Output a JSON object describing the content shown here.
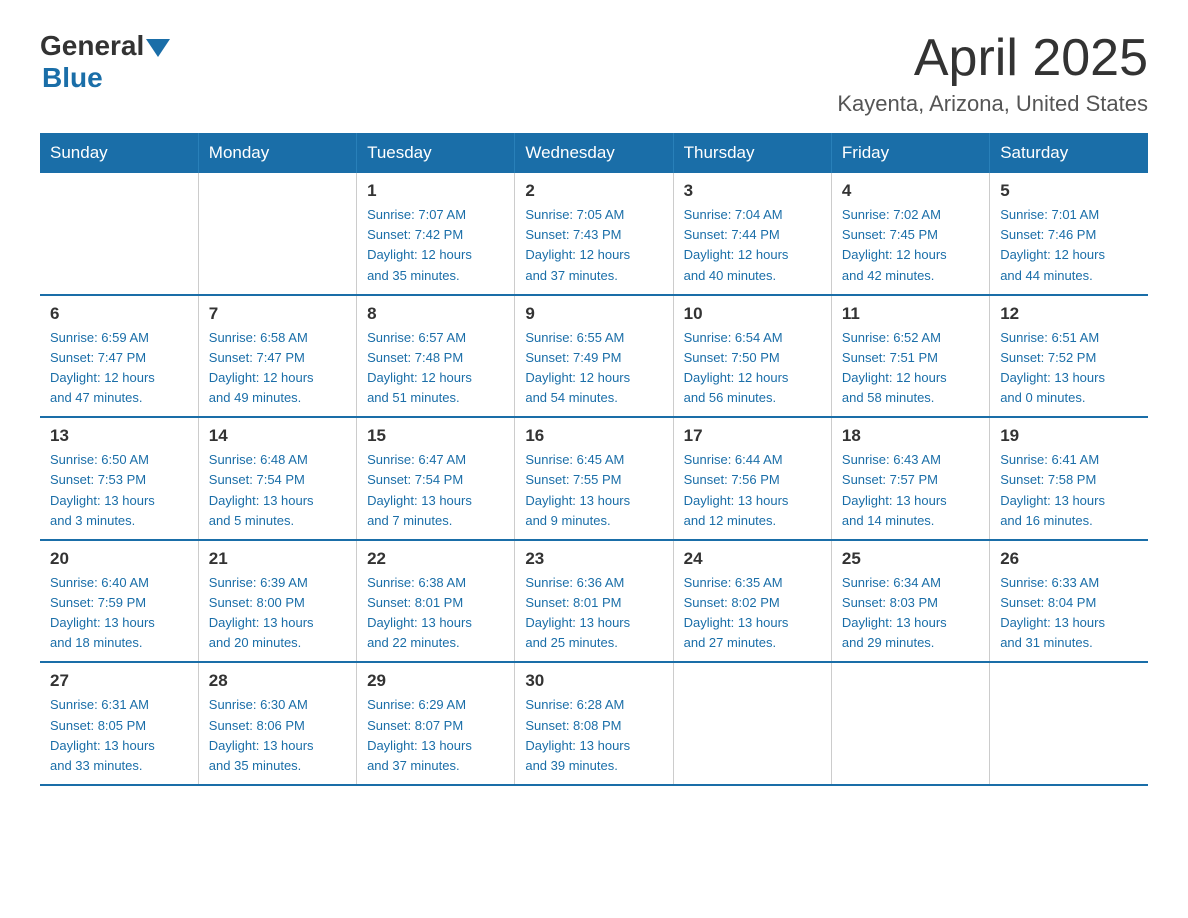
{
  "header": {
    "logo_general": "General",
    "logo_blue": "Blue",
    "month_title": "April 2025",
    "location": "Kayenta, Arizona, United States"
  },
  "days_of_week": [
    "Sunday",
    "Monday",
    "Tuesday",
    "Wednesday",
    "Thursday",
    "Friday",
    "Saturday"
  ],
  "weeks": [
    [
      {
        "day": "",
        "info": ""
      },
      {
        "day": "",
        "info": ""
      },
      {
        "day": "1",
        "info": "Sunrise: 7:07 AM\nSunset: 7:42 PM\nDaylight: 12 hours\nand 35 minutes."
      },
      {
        "day": "2",
        "info": "Sunrise: 7:05 AM\nSunset: 7:43 PM\nDaylight: 12 hours\nand 37 minutes."
      },
      {
        "day": "3",
        "info": "Sunrise: 7:04 AM\nSunset: 7:44 PM\nDaylight: 12 hours\nand 40 minutes."
      },
      {
        "day": "4",
        "info": "Sunrise: 7:02 AM\nSunset: 7:45 PM\nDaylight: 12 hours\nand 42 minutes."
      },
      {
        "day": "5",
        "info": "Sunrise: 7:01 AM\nSunset: 7:46 PM\nDaylight: 12 hours\nand 44 minutes."
      }
    ],
    [
      {
        "day": "6",
        "info": "Sunrise: 6:59 AM\nSunset: 7:47 PM\nDaylight: 12 hours\nand 47 minutes."
      },
      {
        "day": "7",
        "info": "Sunrise: 6:58 AM\nSunset: 7:47 PM\nDaylight: 12 hours\nand 49 minutes."
      },
      {
        "day": "8",
        "info": "Sunrise: 6:57 AM\nSunset: 7:48 PM\nDaylight: 12 hours\nand 51 minutes."
      },
      {
        "day": "9",
        "info": "Sunrise: 6:55 AM\nSunset: 7:49 PM\nDaylight: 12 hours\nand 54 minutes."
      },
      {
        "day": "10",
        "info": "Sunrise: 6:54 AM\nSunset: 7:50 PM\nDaylight: 12 hours\nand 56 minutes."
      },
      {
        "day": "11",
        "info": "Sunrise: 6:52 AM\nSunset: 7:51 PM\nDaylight: 12 hours\nand 58 minutes."
      },
      {
        "day": "12",
        "info": "Sunrise: 6:51 AM\nSunset: 7:52 PM\nDaylight: 13 hours\nand 0 minutes."
      }
    ],
    [
      {
        "day": "13",
        "info": "Sunrise: 6:50 AM\nSunset: 7:53 PM\nDaylight: 13 hours\nand 3 minutes."
      },
      {
        "day": "14",
        "info": "Sunrise: 6:48 AM\nSunset: 7:54 PM\nDaylight: 13 hours\nand 5 minutes."
      },
      {
        "day": "15",
        "info": "Sunrise: 6:47 AM\nSunset: 7:54 PM\nDaylight: 13 hours\nand 7 minutes."
      },
      {
        "day": "16",
        "info": "Sunrise: 6:45 AM\nSunset: 7:55 PM\nDaylight: 13 hours\nand 9 minutes."
      },
      {
        "day": "17",
        "info": "Sunrise: 6:44 AM\nSunset: 7:56 PM\nDaylight: 13 hours\nand 12 minutes."
      },
      {
        "day": "18",
        "info": "Sunrise: 6:43 AM\nSunset: 7:57 PM\nDaylight: 13 hours\nand 14 minutes."
      },
      {
        "day": "19",
        "info": "Sunrise: 6:41 AM\nSunset: 7:58 PM\nDaylight: 13 hours\nand 16 minutes."
      }
    ],
    [
      {
        "day": "20",
        "info": "Sunrise: 6:40 AM\nSunset: 7:59 PM\nDaylight: 13 hours\nand 18 minutes."
      },
      {
        "day": "21",
        "info": "Sunrise: 6:39 AM\nSunset: 8:00 PM\nDaylight: 13 hours\nand 20 minutes."
      },
      {
        "day": "22",
        "info": "Sunrise: 6:38 AM\nSunset: 8:01 PM\nDaylight: 13 hours\nand 22 minutes."
      },
      {
        "day": "23",
        "info": "Sunrise: 6:36 AM\nSunset: 8:01 PM\nDaylight: 13 hours\nand 25 minutes."
      },
      {
        "day": "24",
        "info": "Sunrise: 6:35 AM\nSunset: 8:02 PM\nDaylight: 13 hours\nand 27 minutes."
      },
      {
        "day": "25",
        "info": "Sunrise: 6:34 AM\nSunset: 8:03 PM\nDaylight: 13 hours\nand 29 minutes."
      },
      {
        "day": "26",
        "info": "Sunrise: 6:33 AM\nSunset: 8:04 PM\nDaylight: 13 hours\nand 31 minutes."
      }
    ],
    [
      {
        "day": "27",
        "info": "Sunrise: 6:31 AM\nSunset: 8:05 PM\nDaylight: 13 hours\nand 33 minutes."
      },
      {
        "day": "28",
        "info": "Sunrise: 6:30 AM\nSunset: 8:06 PM\nDaylight: 13 hours\nand 35 minutes."
      },
      {
        "day": "29",
        "info": "Sunrise: 6:29 AM\nSunset: 8:07 PM\nDaylight: 13 hours\nand 37 minutes."
      },
      {
        "day": "30",
        "info": "Sunrise: 6:28 AM\nSunset: 8:08 PM\nDaylight: 13 hours\nand 39 minutes."
      },
      {
        "day": "",
        "info": ""
      },
      {
        "day": "",
        "info": ""
      },
      {
        "day": "",
        "info": ""
      }
    ]
  ]
}
